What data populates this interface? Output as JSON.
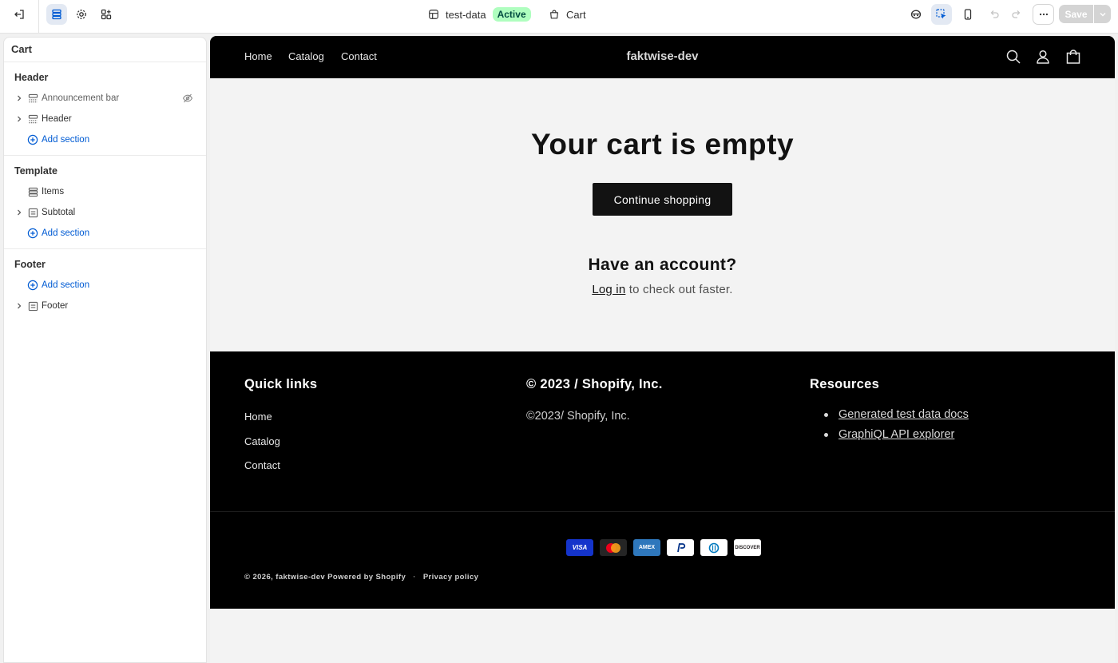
{
  "topbar": {
    "theme_name": "test-data",
    "theme_status": "Active",
    "page_name": "Cart",
    "save_label": "Save"
  },
  "sidebar": {
    "title": "Cart",
    "groups": [
      {
        "heading": "Header",
        "items": [
          {
            "label": "Announcement bar"
          },
          {
            "label": "Header"
          }
        ],
        "add_label": "Add section"
      },
      {
        "heading": "Template",
        "items": [
          {
            "label": "Items"
          },
          {
            "label": "Subtotal"
          }
        ],
        "add_label": "Add section"
      },
      {
        "heading": "Footer",
        "add_label": "Add section",
        "items": [
          {
            "label": "Footer"
          }
        ]
      }
    ]
  },
  "preview": {
    "nav": [
      "Home",
      "Catalog",
      "Contact"
    ],
    "brand": "faktwise-dev",
    "empty_title": "Your cart is empty",
    "continue_label": "Continue shopping",
    "account_title": "Have an account?",
    "login_link": "Log in",
    "login_suffix": " to check out faster.",
    "footer": {
      "quick_links_title": "Quick links",
      "quick_links": [
        "Home",
        "Catalog",
        "Contact"
      ],
      "middle_title": "© 2023 / Shopify, Inc.",
      "middle_text": "©2023/ Shopify, Inc.",
      "resources_title": "Resources",
      "resources": [
        "Generated test data docs",
        "GraphiQL API explorer"
      ],
      "payments": [
        "VISA",
        "mastercard",
        "AMEX",
        "PayPal",
        "Diners",
        "DISCOVER"
      ],
      "copyright_prefix": "© 2026, ",
      "copyright_store": "faktwise-dev",
      "powered_by": "Powered by Shopify",
      "separator": "·",
      "privacy": "Privacy policy"
    }
  },
  "colors": {
    "accent": "#005bd3",
    "badge_bg": "#affebf",
    "shop_dark": "#000000",
    "button_dark": "#121212"
  }
}
